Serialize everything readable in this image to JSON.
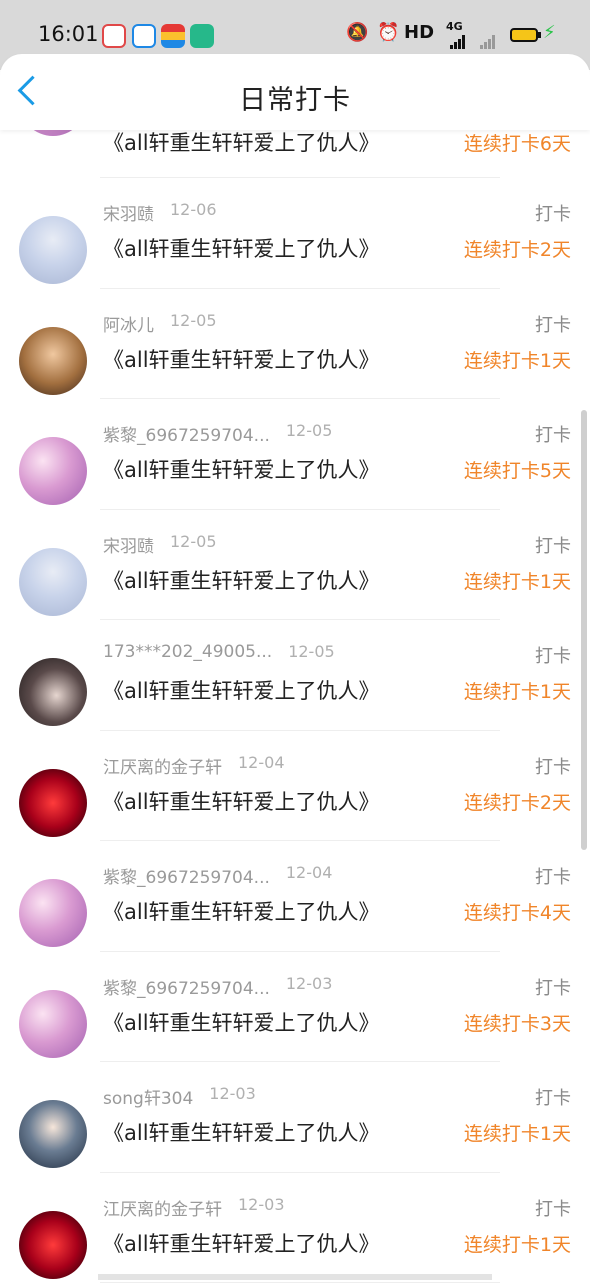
{
  "status_bar": {
    "time": "16:01",
    "app_icons": [
      "baidu-icon",
      "browser-icon",
      "stack-icon",
      "green-app-icon"
    ],
    "hd_label": "HD",
    "network_label": "4G",
    "battery_color": "#f5c518",
    "charging_color": "#2bc34a"
  },
  "header": {
    "title": "日常打卡",
    "accent_color": "#1a9be6"
  },
  "colors": {
    "streak": "#f0852a",
    "name": "#9a9a9a"
  },
  "list": [
    {
      "name": "",
      "date": "",
      "book": "《all轩重生轩轩爱上了仇人》",
      "tag": "",
      "streak": "连续打卡6天",
      "avatar": "anime",
      "partial": true
    },
    {
      "name": "宋羽赜",
      "date": "12-06",
      "book": "《all轩重生轩轩爱上了仇人》",
      "tag": "打卡",
      "streak": "连续打卡2天",
      "avatar": "boy"
    },
    {
      "name": "阿冰儿",
      "date": "12-05",
      "book": "《all轩重生轩轩爱上了仇人》",
      "tag": "打卡",
      "streak": "连续打卡1天",
      "avatar": "warm"
    },
    {
      "name": "紫黎_6967259704...",
      "date": "12-05",
      "book": "《all轩重生轩轩爱上了仇人》",
      "tag": "打卡",
      "streak": "连续打卡5天",
      "avatar": "anime"
    },
    {
      "name": "宋羽赜",
      "date": "12-05",
      "book": "《all轩重生轩轩爱上了仇人》",
      "tag": "打卡",
      "streak": "连续打卡1天",
      "avatar": "boy"
    },
    {
      "name": "173***202_49005...",
      "date": "12-05",
      "book": "《all轩重生轩轩爱上了仇人》",
      "tag": "打卡",
      "streak": "连续打卡1天",
      "avatar": "dark"
    },
    {
      "name": "江厌离的金子轩",
      "date": "12-04",
      "book": "《all轩重生轩轩爱上了仇人》",
      "tag": "打卡",
      "streak": "连续打卡2天",
      "avatar": "red"
    },
    {
      "name": "紫黎_6967259704...",
      "date": "12-04",
      "book": "《all轩重生轩轩爱上了仇人》",
      "tag": "打卡",
      "streak": "连续打卡4天",
      "avatar": "anime"
    },
    {
      "name": "紫黎_6967259704...",
      "date": "12-03",
      "book": "《all轩重生轩轩爱上了仇人》",
      "tag": "打卡",
      "streak": "连续打卡3天",
      "avatar": "anime"
    },
    {
      "name": "song轩304",
      "date": "12-03",
      "book": "《all轩重生轩轩爱上了仇人》",
      "tag": "打卡",
      "streak": "连续打卡1天",
      "avatar": "cap"
    },
    {
      "name": "江厌离的金子轩",
      "date": "12-03",
      "book": "《all轩重生轩轩爱上了仇人》",
      "tag": "打卡",
      "streak": "连续打卡1天",
      "avatar": "red"
    }
  ]
}
